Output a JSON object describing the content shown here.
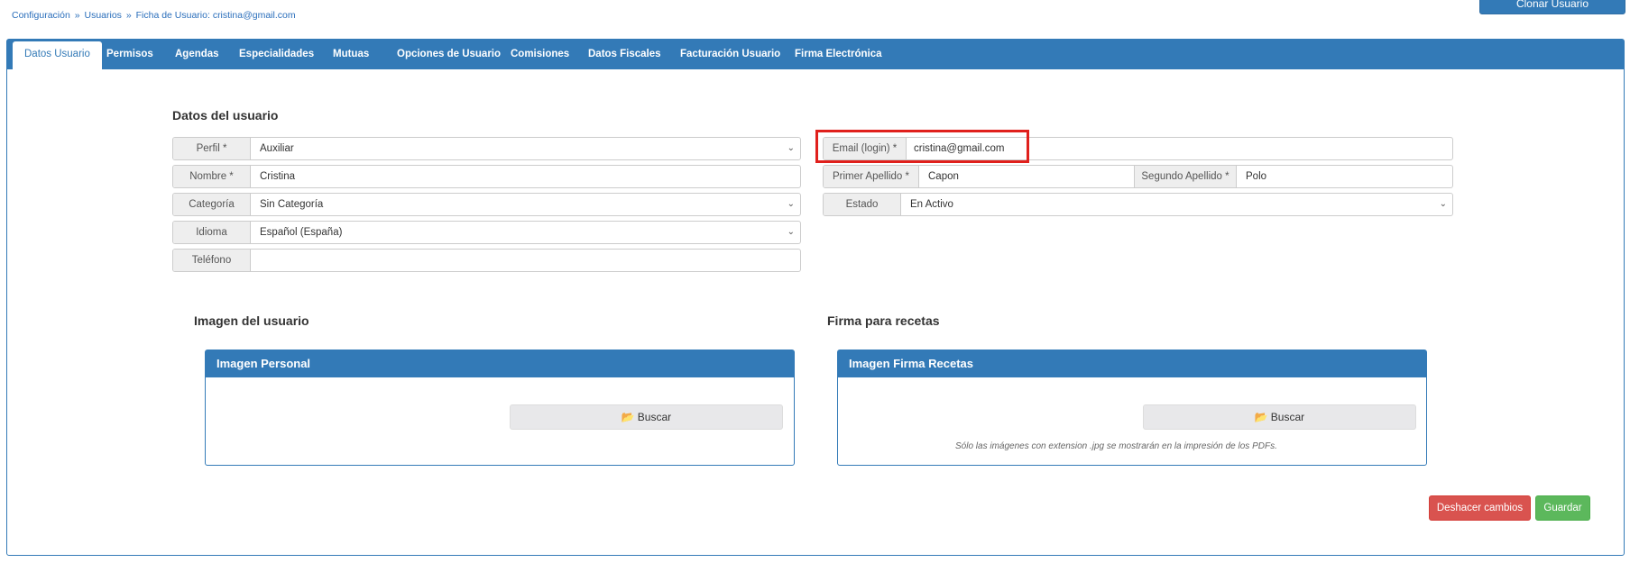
{
  "breadcrumb": {
    "items": [
      "Configuración",
      "Usuarios",
      "Ficha de Usuario: cristina@gmail.com"
    ],
    "separator": "»"
  },
  "header": {
    "clone_button": "Clonar Usuario"
  },
  "tabs": [
    "Datos Usuario",
    "Permisos",
    "Agendas",
    "Especialidades",
    "Mutuas",
    "Opciones de Usuario",
    "Comisiones",
    "Datos Fiscales",
    "Facturación Usuario",
    "Firma Electrónica"
  ],
  "user_data": {
    "title": "Datos del usuario",
    "perfil": {
      "label": "Perfil *",
      "value": "Auxiliar"
    },
    "nombre": {
      "label": "Nombre *",
      "value": "Cristina"
    },
    "categoria": {
      "label": "Categoría",
      "value": "Sin Categoría"
    },
    "idioma": {
      "label": "Idioma",
      "value": "Español (España)"
    },
    "telefono": {
      "label": "Teléfono",
      "value": ""
    },
    "email": {
      "label": "Email (login) *",
      "value": "cristina@gmail.com"
    },
    "primer_apellido": {
      "label": "Primer Apellido *",
      "value": "Capon"
    },
    "segundo_apellido": {
      "label": "Segundo Apellido *",
      "value": "Polo"
    },
    "estado": {
      "label": "Estado",
      "value": "En Activo"
    }
  },
  "user_image": {
    "title": "Imagen del usuario",
    "panel_title": "Imagen Personal",
    "button": "Buscar"
  },
  "signature": {
    "title": "Firma para recetas",
    "panel_title": "Imagen Firma Recetas",
    "button": "Buscar",
    "note": "Sólo las imágenes con extension .jpg se mostrarán en la impresión de los PDFs."
  },
  "actions": {
    "undo": "Deshacer cambios",
    "save": "Guardar"
  },
  "colors": {
    "primary": "#337ab7",
    "danger": "#d9534f",
    "success": "#5cb85c",
    "highlight": "#e0201c"
  }
}
